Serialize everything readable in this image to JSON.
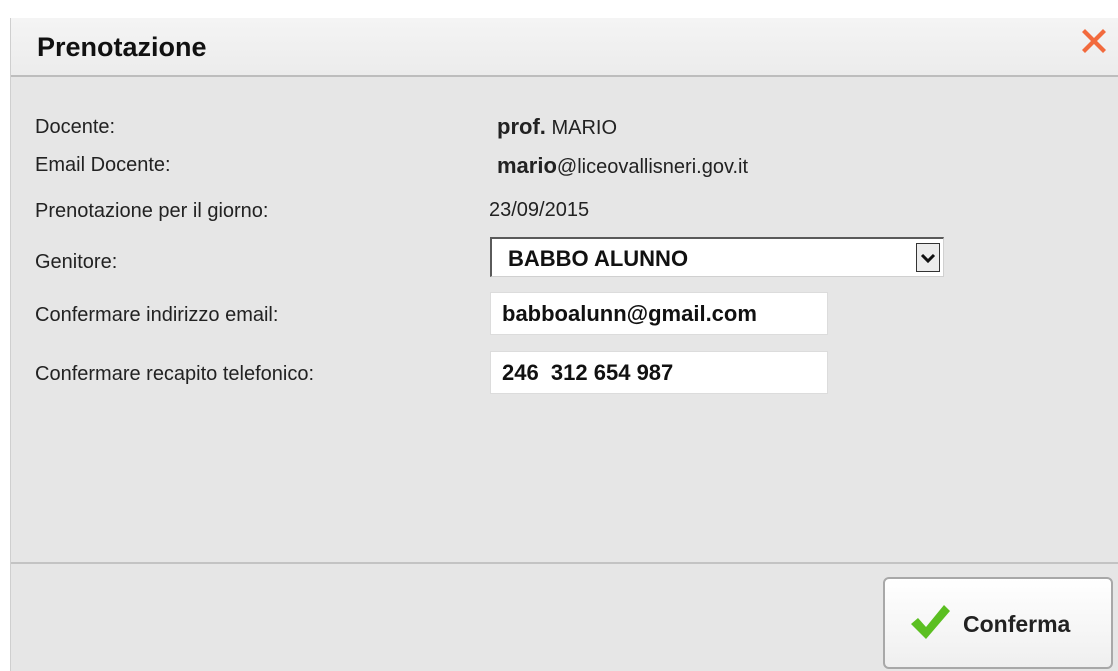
{
  "dialog": {
    "title": "Prenotazione",
    "close_icon": "close-x-icon"
  },
  "info": {
    "docente_label": "Docente:",
    "docente_prefix": "prof.",
    "docente_name": "MARIO",
    "email_label": "Email Docente:",
    "email_user": "mario",
    "email_domain": "@liceovallisneri.gov.it",
    "date_label": "Prenotazione per il giorno:",
    "date_value": "23/09/2015"
  },
  "form": {
    "genitore_label": "Genitore:",
    "genitore_value": "BABBO ALUNNO",
    "email_confirm_label": "Confermare indirizzo email:",
    "email_confirm_value": "babboalunn@gmail.com",
    "phone_confirm_label": "Confermare recapito telefonico:",
    "phone_confirm_value": "246  312 654 987"
  },
  "footer": {
    "confirm_label": "Conferma",
    "confirm_icon": "checkmark-icon"
  },
  "colors": {
    "close": "#f26a3d",
    "check": "#5bbf21",
    "background": "#e6e6e6"
  }
}
